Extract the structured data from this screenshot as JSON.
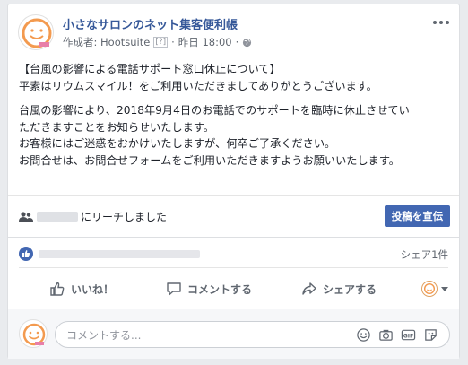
{
  "post": {
    "page_name": "小さなサロンのネット集客便利帳",
    "author_prefix": "作成者: Hootsuite",
    "info_badge": "[?]",
    "dot": "·",
    "time": "昨日 18:00",
    "dot2": "·",
    "body": [
      "【台風の影響による電話サポート窓口休止について】",
      "平素はリウムスマイル！をご利用いただきましてありがとうございます。",
      "台風の影響により、2018年9月4日のお電話でのサポートを臨時に休止させてい",
      "ただきますことをお知らせいたします。",
      "お客様にはご迷惑をおかけいたしますが、何卒ご了承ください。",
      "お問合せは、お問合せフォームをご利用いただきますようお願いいたします。"
    ],
    "reach_suffix": "にリーチしました",
    "boost_label": "投稿を宣伝",
    "share_count": "シェア1件"
  },
  "actions": {
    "like": "いいね！",
    "comment": "コメントする",
    "share": "シェアする"
  },
  "comment": {
    "placeholder": "コメントする..."
  },
  "colors": {
    "brand_blue": "#4267b2",
    "link_blue": "#365899",
    "muted": "#616770"
  },
  "icons": [
    "more-icon",
    "globe-icon",
    "people-icon",
    "like-badge-icon",
    "thumbs-up-icon",
    "comment-icon",
    "share-icon",
    "caret-down-icon",
    "emoji-icon",
    "camera-icon",
    "gif-icon",
    "sticker-icon"
  ]
}
